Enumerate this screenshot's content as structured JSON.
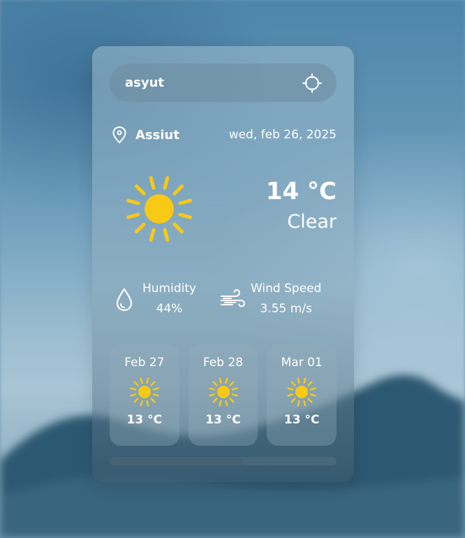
{
  "search": {
    "value": "asyut",
    "locate_icon": "crosshair-icon"
  },
  "location": {
    "icon": "location-pin-icon",
    "city": "Assiut",
    "date": "wed, feb 26, 2025"
  },
  "current": {
    "icon": "sun-icon",
    "temperature": "14 °C",
    "condition": "Clear"
  },
  "stats": {
    "humidity": {
      "icon": "droplet-icon",
      "label": "Humidity",
      "value": "44%"
    },
    "wind": {
      "icon": "wind-icon",
      "label": "Wind Speed",
      "value": "3.55 m/s"
    }
  },
  "forecast": [
    {
      "date": "Feb 27",
      "icon": "sun-icon",
      "temp": "13 °C"
    },
    {
      "date": "Feb 28",
      "icon": "sun-icon",
      "temp": "13 °C"
    },
    {
      "date": "Mar 01",
      "icon": "sun-icon",
      "temp": "13 °C"
    }
  ],
  "scrollbar": {
    "visible_fraction": 0.59
  },
  "colors": {
    "sun": "#f8c915",
    "text": "#ffffff"
  }
}
